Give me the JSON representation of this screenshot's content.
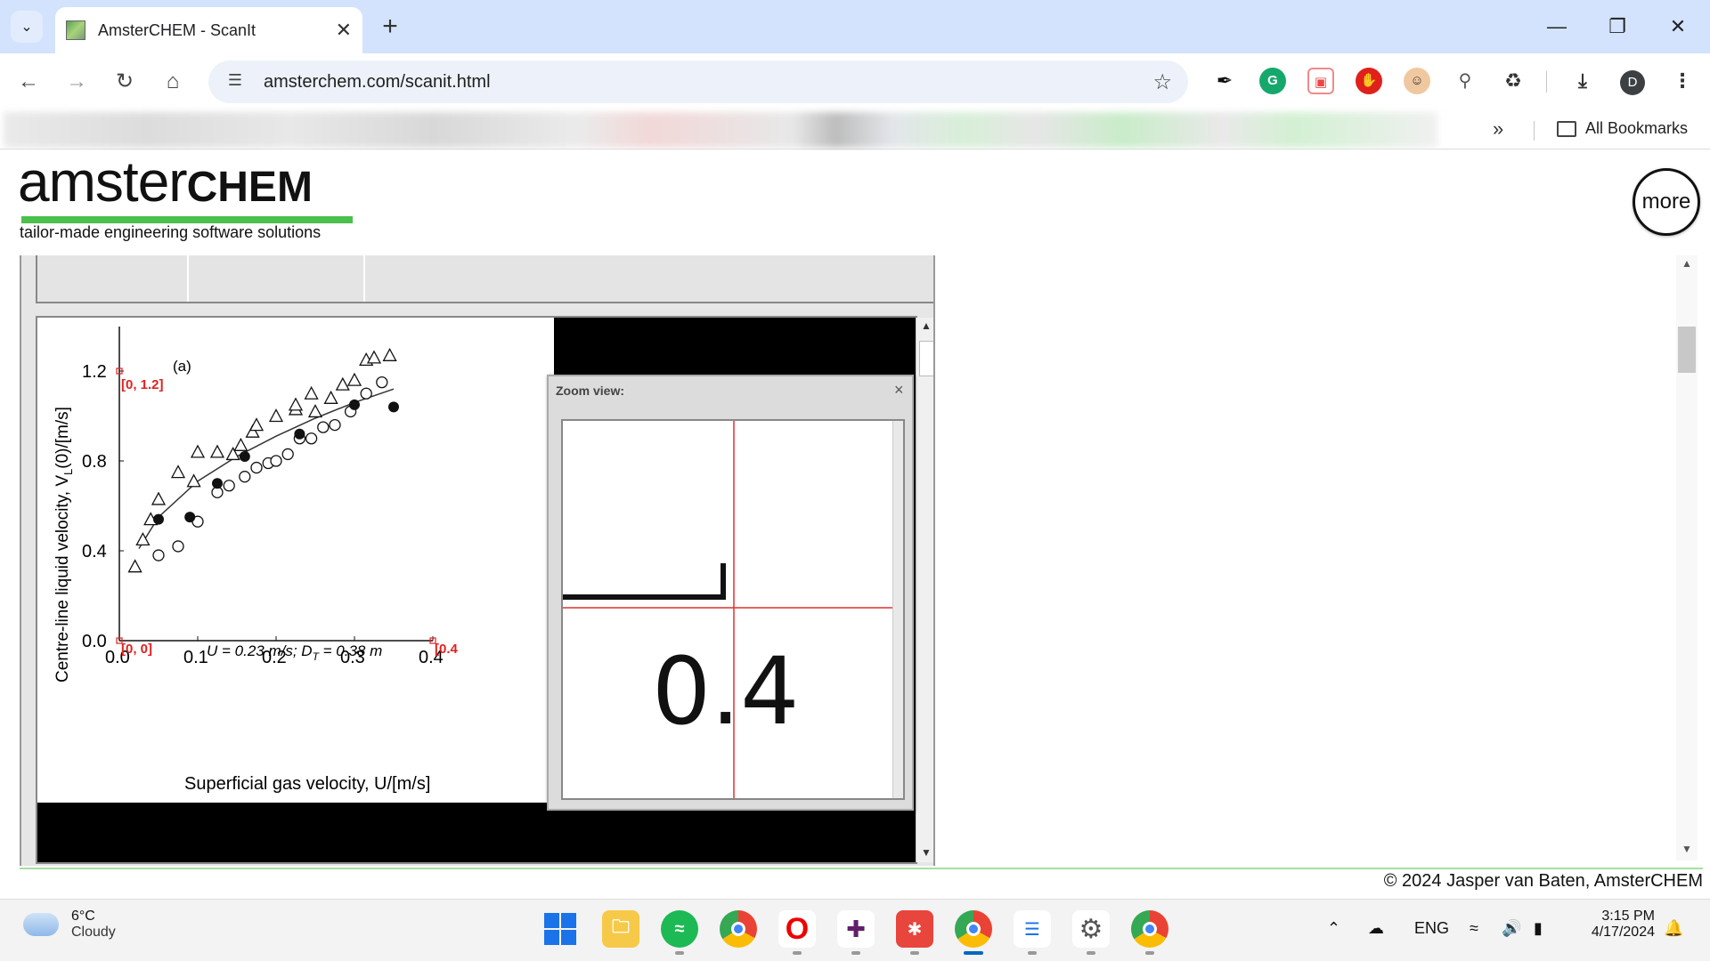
{
  "browser": {
    "tab_title": "AmsterCHEM - ScanIt",
    "url": "amsterchem.com/scanit.html",
    "all_bookmarks_label": "All Bookmarks",
    "profile_initial": "D"
  },
  "page": {
    "logo_text_lower": "amster",
    "logo_text_upper": "CHEM",
    "logo_tagline": "tailor-made engineering software solutions",
    "more_button": "more",
    "copyright": "© 2024 Jasper van Baten, AmsterCHEM"
  },
  "zoom_view": {
    "title": "Zoom view:",
    "close_label": "×",
    "magnified_text": "0.4"
  },
  "scanned_image": {
    "panel_label": "(a)",
    "annotation": "U = 0.23 m/s; D",
    "annotation_sub": "T",
    "annotation_tail": " = 0.38 m",
    "xlabel": "Superficial gas velocity, U/[m/s]",
    "ylabel": "Centre-line liquid velocity, V",
    "ylabel_sub": "L",
    "ylabel_tail": "(0)/[m/s]",
    "calibration_points": [
      "[0, 1.2]",
      "[0, 0]",
      "[0.4"
    ]
  },
  "chart_data": {
    "type": "scatter",
    "title": "",
    "xlabel": "Superficial gas velocity, U/[m/s]",
    "ylabel": "Centre-line liquid velocity, VL(0)/[m/s]",
    "xlim": [
      0,
      0.4
    ],
    "ylim": [
      0,
      1.2
    ],
    "x_ticks": [
      "0.0",
      "0.1",
      "0.2",
      "0.3",
      "0.4"
    ],
    "y_ticks": [
      "0.0",
      "0.4",
      "0.8",
      "1.2"
    ],
    "series": [
      {
        "marker": "open-triangle",
        "points": [
          [
            0.02,
            0.33
          ],
          [
            0.03,
            0.45
          ],
          [
            0.04,
            0.54
          ],
          [
            0.05,
            0.63
          ],
          [
            0.075,
            0.75
          ],
          [
            0.095,
            0.71
          ],
          [
            0.1,
            0.84
          ],
          [
            0.125,
            0.84
          ],
          [
            0.145,
            0.83
          ],
          [
            0.155,
            0.87
          ],
          [
            0.17,
            0.93
          ],
          [
            0.175,
            0.96
          ],
          [
            0.2,
            1.0
          ],
          [
            0.225,
            1.03
          ],
          [
            0.225,
            1.05
          ],
          [
            0.245,
            1.1
          ],
          [
            0.25,
            1.02
          ],
          [
            0.27,
            1.08
          ],
          [
            0.285,
            1.14
          ],
          [
            0.3,
            1.16
          ],
          [
            0.315,
            1.25
          ],
          [
            0.325,
            1.26
          ],
          [
            0.345,
            1.27
          ]
        ]
      },
      {
        "marker": "open-circle",
        "points": [
          [
            0.05,
            0.38
          ],
          [
            0.075,
            0.42
          ],
          [
            0.1,
            0.53
          ],
          [
            0.125,
            0.66
          ],
          [
            0.14,
            0.69
          ],
          [
            0.16,
            0.73
          ],
          [
            0.175,
            0.77
          ],
          [
            0.19,
            0.79
          ],
          [
            0.2,
            0.8
          ],
          [
            0.215,
            0.83
          ],
          [
            0.23,
            0.9
          ],
          [
            0.245,
            0.9
          ],
          [
            0.26,
            0.95
          ],
          [
            0.275,
            0.96
          ],
          [
            0.295,
            1.02
          ],
          [
            0.315,
            1.1
          ],
          [
            0.335,
            1.15
          ]
        ]
      },
      {
        "marker": "filled-circle",
        "points": [
          [
            0.05,
            0.54
          ],
          [
            0.09,
            0.55
          ],
          [
            0.125,
            0.7
          ],
          [
            0.16,
            0.82
          ],
          [
            0.23,
            0.92
          ],
          [
            0.3,
            1.05
          ],
          [
            0.35,
            1.04
          ]
        ]
      }
    ],
    "fit_curve": [
      [
        0.025,
        0.41
      ],
      [
        0.05,
        0.55
      ],
      [
        0.1,
        0.71
      ],
      [
        0.15,
        0.82
      ],
      [
        0.2,
        0.91
      ],
      [
        0.25,
        0.99
      ],
      [
        0.3,
        1.06
      ],
      [
        0.35,
        1.12
      ]
    ]
  },
  "taskbar": {
    "weather_temp": "6°C",
    "weather_cond": "Cloudy",
    "lang": "ENG",
    "time": "3:15 PM",
    "date": "4/17/2024"
  }
}
